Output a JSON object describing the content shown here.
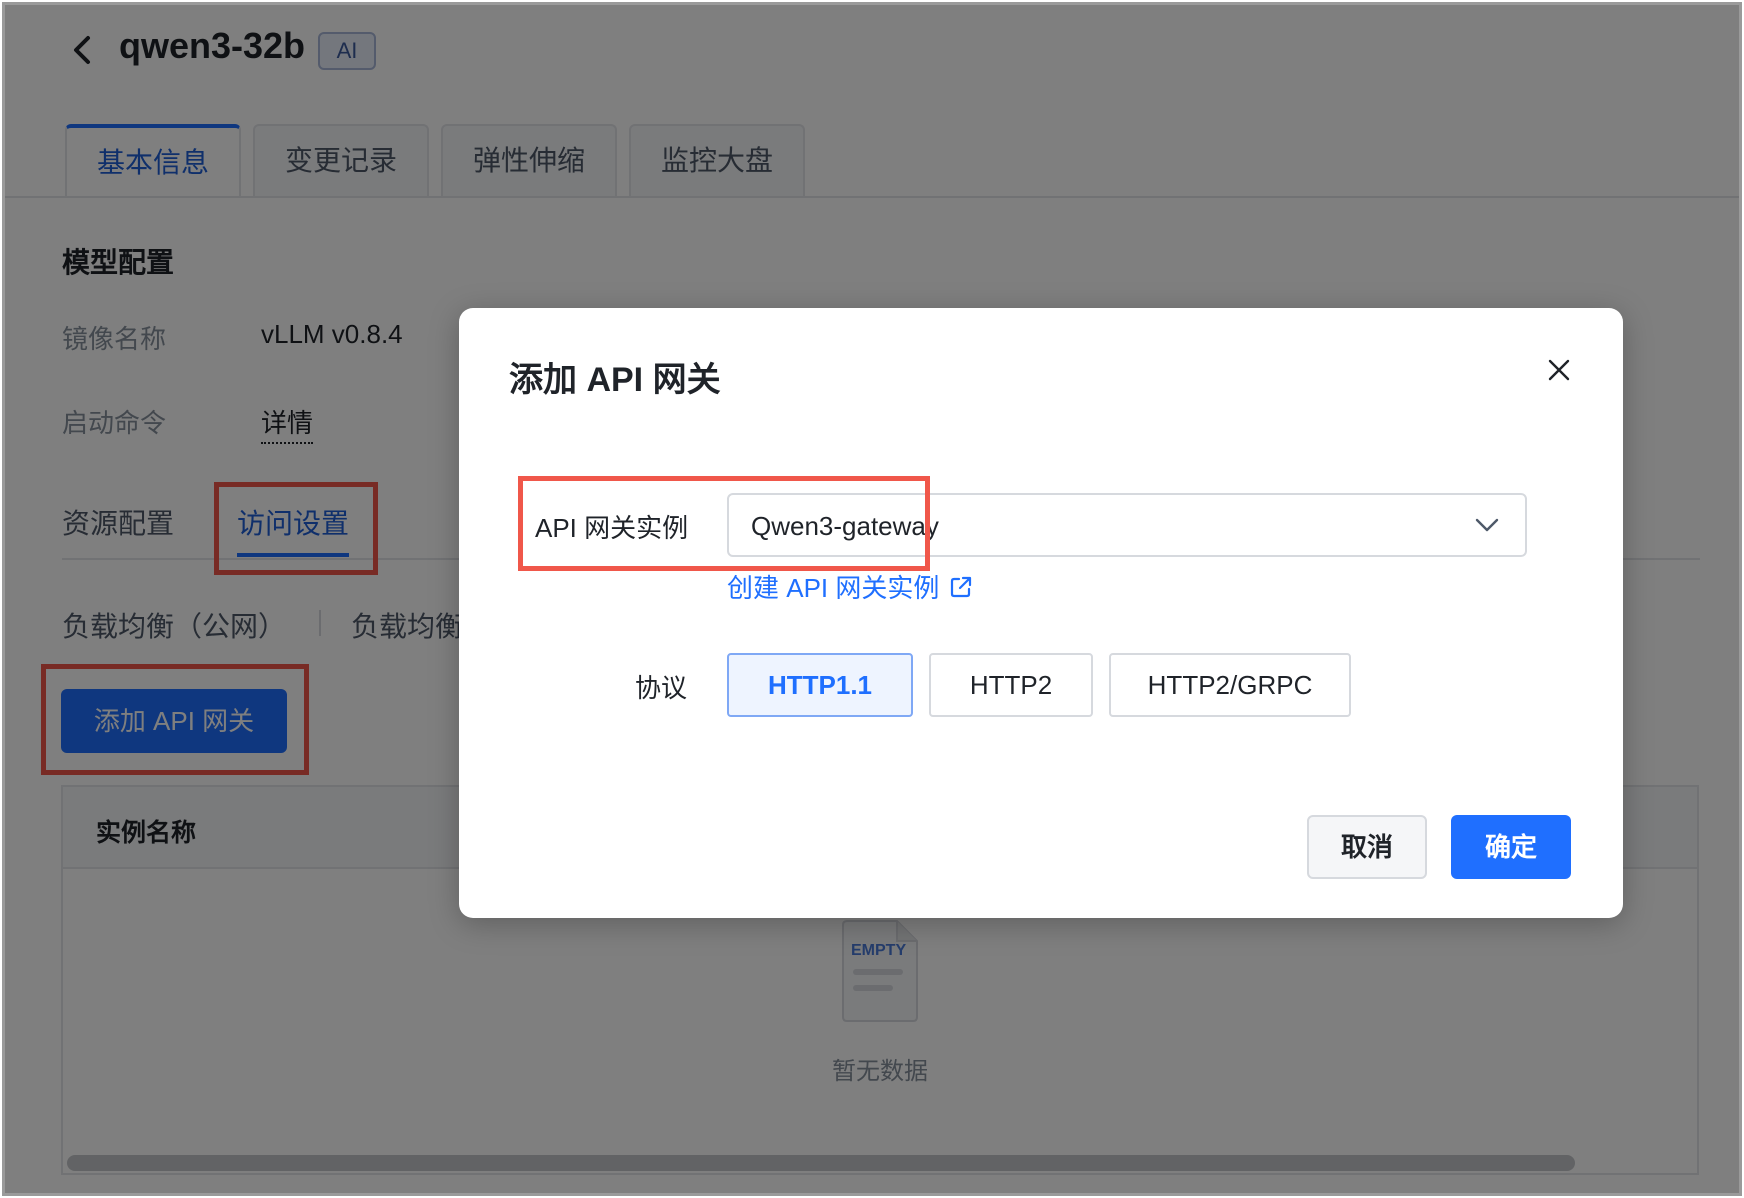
{
  "header": {
    "title": "qwen3-32b",
    "badge": "AI"
  },
  "tabs": [
    {
      "label": "基本信息",
      "active": true
    },
    {
      "label": "变更记录",
      "active": false
    },
    {
      "label": "弹性伸缩",
      "active": false
    },
    {
      "label": "监控大盘",
      "active": false
    }
  ],
  "model_config": {
    "section_title": "模型配置",
    "image_label": "镜像名称",
    "image_value": "vLLM v0.8.4",
    "command_label": "启动命令",
    "command_value": "详情"
  },
  "subtabs": {
    "resource": "资源配置",
    "access": "访问设置"
  },
  "lb_tabs": {
    "public": "负载均衡（公网）",
    "private_partial": "负载均衡"
  },
  "add_gateway_button": "添加 API 网关",
  "table": {
    "column_instance": "实例名称",
    "empty_icon_text": "EMPTY",
    "empty_text": "暂无数据"
  },
  "modal": {
    "title": "添加 API 网关",
    "instance_label": "API 网关实例",
    "instance_value": "Qwen3-gateway",
    "create_link": "创建 API 网关实例",
    "protocol_label": "协议",
    "protocols": [
      {
        "label": "HTTP1.1",
        "selected": true
      },
      {
        "label": "HTTP2",
        "selected": false
      },
      {
        "label": "HTTP2/GRPC",
        "selected": false
      }
    ],
    "cancel": "取消",
    "confirm": "确定"
  },
  "colors": {
    "primary": "#1f6fff",
    "highlight_box": "#f0574a",
    "overlay": "rgba(0,0,0,0.5)"
  }
}
